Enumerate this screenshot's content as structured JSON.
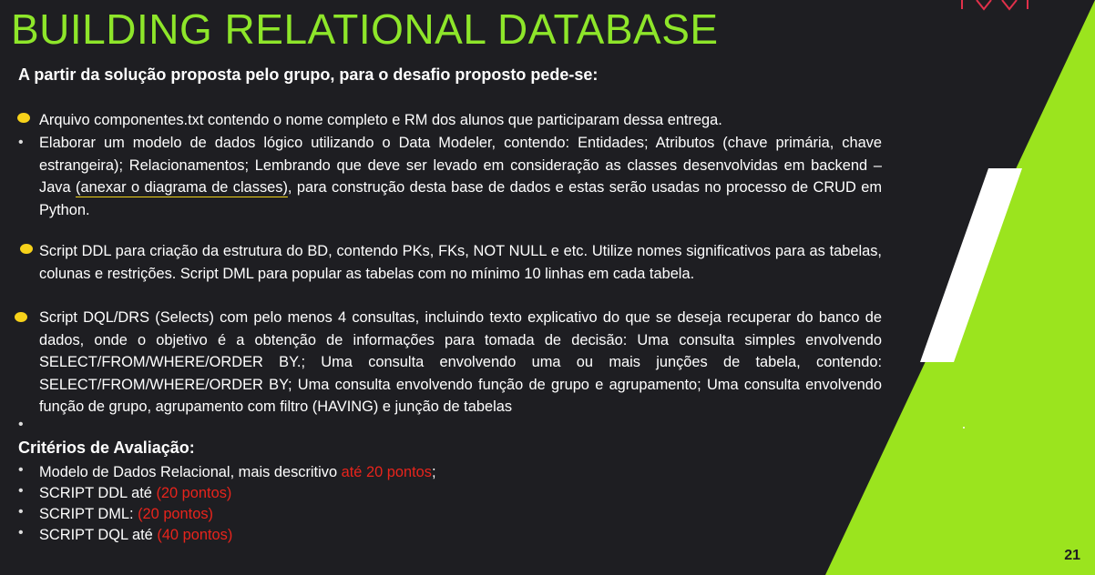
{
  "title": "BUILDING RELATIONAL DATABASE",
  "intro": "A partir da solução proposta pelo grupo, para o desafio proposto pede-se:",
  "items": {
    "i1": "Arquivo componentes.txt contendo o nome completo e RM dos alunos que participaram dessa entrega.",
    "i2a": "Elaborar um modelo de dados lógico utilizando o Data Modeler, contendo: Entidades; Atributos (chave primária, chave estrangeira); Relacionamentos; Lembrando que deve ser levado em consideração as classes desenvolvidas em backend – Java ",
    "i2b": "(anexar o diagrama de classes)",
    "i2c": ", para construção desta base de dados e estas serão usadas no processo de CRUD em Python.",
    "i3": "Script DDL para criação da estrutura do BD, contendo PKs, FKs, NOT NULL e etc. Utilize nomes significativos para as tabelas, colunas e restrições. Script DML para popular as tabelas com no mínimo 10 linhas em cada tabela.",
    "i4": "Script DQL/DRS (Selects) com pelo menos 4 consultas, incluindo texto explicativo do que se deseja recuperar do banco de dados, onde o objetivo é a obtenção de informações para tomada de decisão: Uma consulta simples envolvendo SELECT/FROM/WHERE/ORDER BY.; Uma consulta envolvendo uma ou mais junções de tabela, contendo: SELECT/FROM/WHERE/ORDER BY; Uma consulta envolvendo função de grupo e agrupamento; Uma consulta envolvendo função de grupo, agrupamento com filtro (HAVING) e junção de tabelas"
  },
  "criteria": {
    "title": "Critérios de Avaliação:",
    "c1_text": "Modelo de Dados Relacional, mais descritivo ",
    "c1_points": "até 20 pontos",
    "c1_end": ";",
    "c2_text": "SCRIPT DDL até ",
    "c2_points": "(20 pontos)",
    "c3_text": "SCRIPT DML: ",
    "c3_points": "(20 pontos)",
    "c4_text": "SCRIPT DQL até ",
    "c4_points": "(40 pontos)"
  },
  "page_number": "21",
  "colors": {
    "accent": "#8ee62a",
    "background": "#1e1e22",
    "highlight": "#f7d21a",
    "points": "#e8241c"
  }
}
